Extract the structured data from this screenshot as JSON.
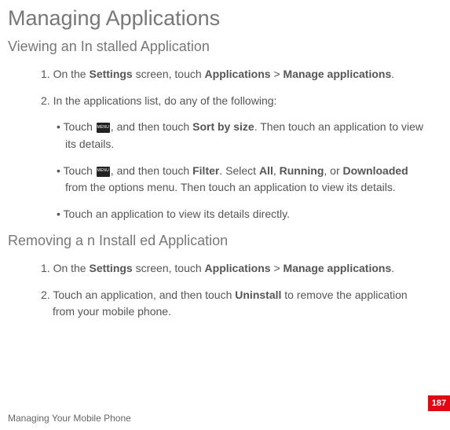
{
  "page": {
    "title": "Managing Applications",
    "footer": "Managing Your Mobile Phone",
    "page_number": "187"
  },
  "sec1": {
    "title": "Viewing an In stalled Application",
    "step1_a": "1. On the ",
    "step1_b": "Settings",
    "step1_c": " screen, touch ",
    "step1_d": "Applications",
    "step1_e": " > ",
    "step1_f": "Manage applications",
    "step1_g": ".",
    "step2": "2. In the applications list, do any of the following:",
    "b1_a": "• Touch ",
    "b1_b": ", and then touch ",
    "b1_c": "Sort by size",
    "b1_d": ". Then touch an application to view its details.",
    "b2_a": "• Touch ",
    "b2_b": ", and then touch ",
    "b2_c": "Filter",
    "b2_d": ". Select ",
    "b2_e": "All",
    "b2_f": ", ",
    "b2_g": "Running",
    "b2_h": ", or ",
    "b2_i": "Downloaded",
    "b2_j": " from the options menu. Then touch an application to view its details.",
    "b3": "• Touch an application to view its details directly."
  },
  "sec2": {
    "title": "Removing a n Install ed Application",
    "step1_a": "1. On the ",
    "step1_b": "Settings",
    "step1_c": " screen, touch ",
    "step1_d": "Applications",
    "step1_e": " > ",
    "step1_f": "Manage applications",
    "step1_g": ".",
    "step2_a": "2. Touch an application, and then touch ",
    "step2_b": "Uninstall",
    "step2_c": " to remove the application from your mobile phone."
  }
}
